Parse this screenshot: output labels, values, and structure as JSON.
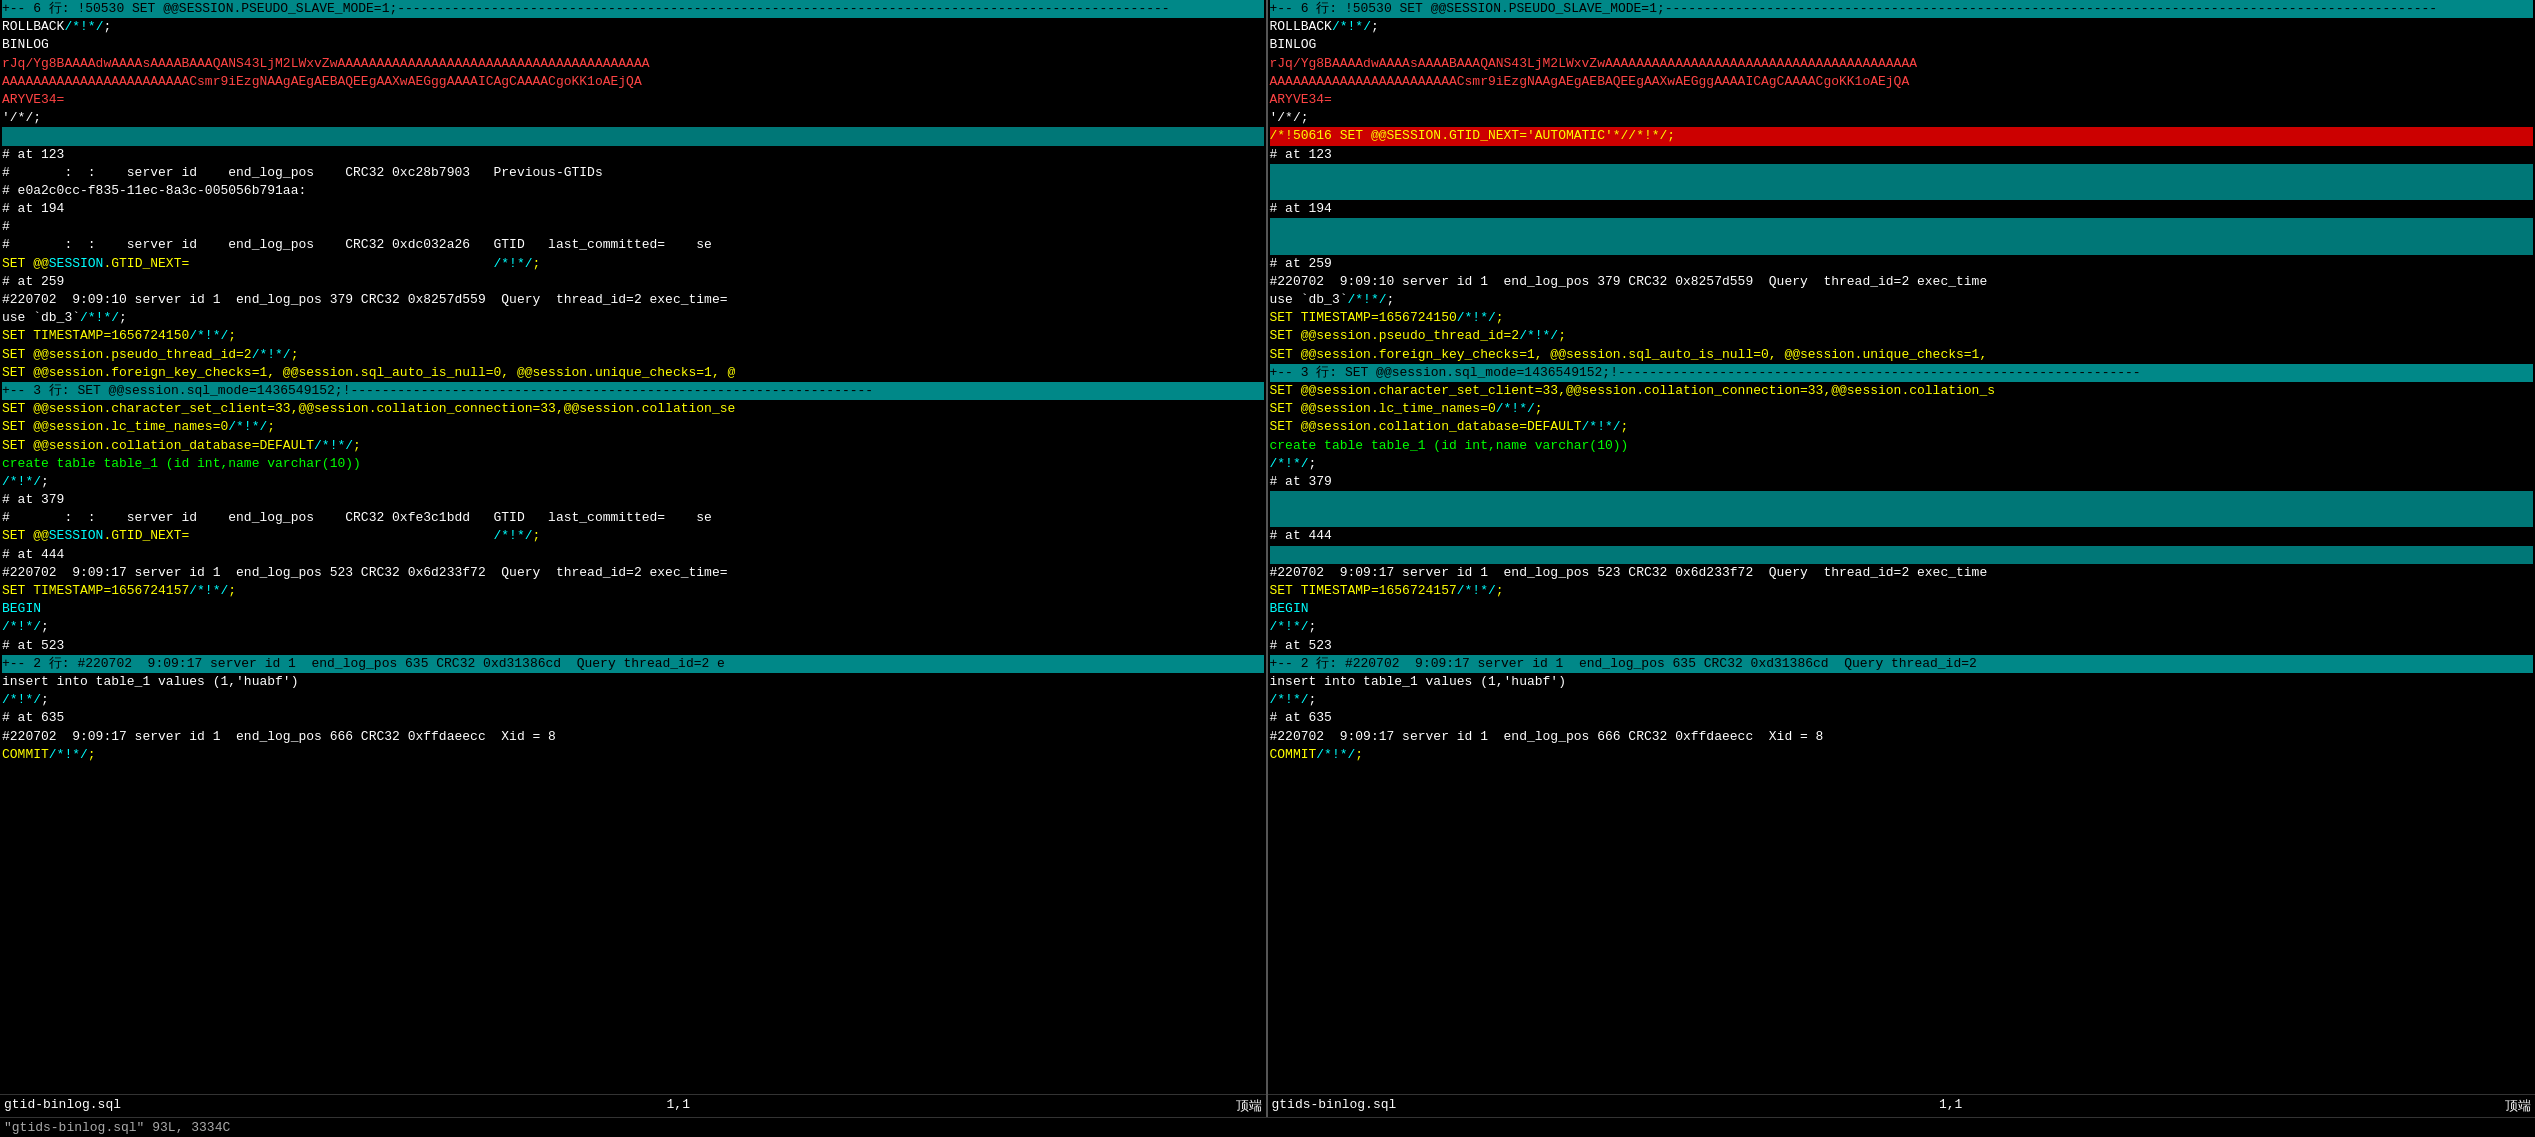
{
  "left_pane": {
    "status_file": "gtid-binlog.sql",
    "status_pos": "1,1",
    "status_loc": "顶端",
    "lines": [
      {
        "type": "bg-cyan",
        "text": "+-- 6 行: !50530 SET @@SESSION.PSEUDO_SLAVE_MODE=1;---------------------------------------------------------------------------------------------------"
      },
      {
        "type": "white",
        "text": "ROLLBACK/*!*/;"
      },
      {
        "type": "white",
        "text": "BINLOG"
      },
      {
        "type": "red",
        "text": "rJq/Yg8BAAAAdwAAAAsAAAABAAAQANS43LjM2LWxvZwAAAAAAAAAAAAAAAAAAAAAAAAAAAAAAAAAAAAAAAA"
      },
      {
        "type": "red",
        "text": "AAAAAAAAAAAAAAAAAAAAAAAACsmr9iEzgNAAgAEgAEBAQEEgAAXwAEGggAAAAICAgCAAAACgoKK1oAEjQA"
      },
      {
        "type": "red",
        "text": "ARYVE34="
      },
      {
        "type": "white",
        "text": "'/*/;"
      },
      {
        "type": "separator",
        "text": ""
      },
      {
        "type": "white",
        "text": "# at 123"
      },
      {
        "type": "white",
        "text": "#       :  :    server id    end_log_pos    CRC32 0xc28b7903   Previous-GTIDs"
      },
      {
        "type": "white",
        "text": "# e0a2c0cc-f835-11ec-8a3c-005056b791aa:"
      },
      {
        "type": "white",
        "text": "# at 194"
      },
      {
        "type": "white",
        "text": "#"
      },
      {
        "type": "white",
        "text": "#       :  :    server id    end_log_pos    CRC32 0xdc032a26   GTID   last_committed=    se"
      },
      {
        "type": "mixed_gtid",
        "text": "SET @@SESSION.GTID_NEXT=                                       /*!*/;"
      },
      {
        "type": "white",
        "text": "# at 259"
      },
      {
        "type": "white",
        "text": "#220702  9:09:10 server id 1  end_log_pos 379 CRC32 0x8257d559  Query  thread_id=2 exec_time="
      },
      {
        "type": "white",
        "text": "use `db_3`/*!*/;"
      },
      {
        "type": "yellow",
        "text": "SET TIMESTAMP=1656724150/*!*/;"
      },
      {
        "type": "yellow",
        "text": "SET @@session.pseudo_thread_id=2/*!*/;"
      },
      {
        "type": "yellow",
        "text": "SET @@session.foreign_key_checks=1, @@session.sql_auto_is_null=0, @@session.unique_checks=1, @"
      },
      {
        "type": "bg-cyan-sep",
        "text": "+-- 3 行: SET @@session.sql_mode=1436549152;!-------------------------------------------------------------------"
      },
      {
        "type": "yellow",
        "text": "SET @@session.character_set_client=33,@@session.collation_connection=33,@@session.collation_se"
      },
      {
        "type": "yellow",
        "text": "SET @@session.lc_time_names=0/*!*/;"
      },
      {
        "type": "yellow",
        "text": "SET @@session.collation_database=DEFAULT/*!*/;"
      },
      {
        "type": "green",
        "text": "create table table_1 (id int,name varchar(10))"
      },
      {
        "type": "white",
        "text": "/*!*/;"
      },
      {
        "type": "white",
        "text": "# at 379"
      },
      {
        "type": "white",
        "text": "#       :  :    server id    end_log_pos    CRC32 0xfe3c1bdd   GTID   last_committed=    se"
      },
      {
        "type": "mixed_gtid2",
        "text": "SET @@SESSION.GTID_NEXT=                                       /*!*/;"
      },
      {
        "type": "white",
        "text": "# at 444"
      },
      {
        "type": "white",
        "text": ""
      },
      {
        "type": "white",
        "text": "#220702  9:09:17 server id 1  end_log_pos 523 CRC32 0x6d233f72  Query  thread_id=2 exec_time="
      },
      {
        "type": "yellow",
        "text": "SET TIMESTAMP=1656724157/*!*/;"
      },
      {
        "type": "cyan",
        "text": "BEGIN"
      },
      {
        "type": "white",
        "text": "/*!*/;"
      },
      {
        "type": "white",
        "text": "# at 523"
      },
      {
        "type": "bg-cyan-sep2",
        "text": "+-- 2 行: #220702  9:09:17 server id 1  end_log_pos 635 CRC32 0xd31386cd  Query thread_id=2 e"
      },
      {
        "type": "white",
        "text": "insert into table_1 values (1,'huabf')"
      },
      {
        "type": "white",
        "text": "/*!*/;"
      },
      {
        "type": "white",
        "text": "# at 635"
      },
      {
        "type": "white",
        "text": "#220702  9:09:17 server id 1  end_log_pos 666 CRC32 0xffdaeecc  Xid = 8"
      },
      {
        "type": "yellow",
        "text": "COMMIT/*!*/;"
      }
    ]
  },
  "right_pane": {
    "status_file": "gtids-binlog.sql",
    "status_pos": "1,1",
    "status_loc": "顶端",
    "lines": [
      {
        "type": "bg-cyan",
        "text": "+-- 6 行: !50530 SET @@SESSION.PSEUDO_SLAVE_MODE=1;---------------------------------------------------------------------------------------------------"
      },
      {
        "type": "white",
        "text": "ROLLBACK/*!*/;"
      },
      {
        "type": "white",
        "text": "BINLOG"
      },
      {
        "type": "red",
        "text": "rJq/Yg8BAAAAdwAAAAsAAAABAAAQANS43LjM2LWxvZwAAAAAAAAAAAAAAAAAAAAAAAAAAAAAAAAAAAAAAAA"
      },
      {
        "type": "red",
        "text": "AAAAAAAAAAAAAAAAAAAAAAAACsmr9iEzgNAAgAEgAEBAQEEgAAXwAEGggAAAAICAgCAAAACgoKK1oAEjQA"
      },
      {
        "type": "red",
        "text": "ARYVE34="
      },
      {
        "type": "white",
        "text": "'/*/;"
      },
      {
        "type": "bg-red-line",
        "text": "/*!50616 SET @@SESSION.GTID_NEXT='AUTOMATIC'*//*!*/;"
      },
      {
        "type": "white",
        "text": "# at 123"
      },
      {
        "type": "separator-empty",
        "text": ""
      },
      {
        "type": "separator-empty2",
        "text": ""
      },
      {
        "type": "white",
        "text": "# at 194"
      },
      {
        "type": "separator-empty3",
        "text": ""
      },
      {
        "type": "separator-empty4",
        "text": ""
      },
      {
        "type": "white",
        "text": "# at 259"
      },
      {
        "type": "white",
        "text": "#220702  9:09:10 server id 1  end_log_pos 379 CRC32 0x8257d559  Query  thread_id=2 exec_time"
      },
      {
        "type": "white",
        "text": "use `db_3`/*!*/;"
      },
      {
        "type": "yellow",
        "text": "SET TIMESTAMP=1656724150/*!*/;"
      },
      {
        "type": "yellow",
        "text": "SET @@session.pseudo_thread_id=2/*!*/;"
      },
      {
        "type": "yellow",
        "text": "SET @@session.foreign_key_checks=1, @@session.sql_auto_is_null=0, @@session.unique_checks=1,"
      },
      {
        "type": "bg-cyan-sep",
        "text": "+-- 3 行: SET @@session.sql_mode=1436549152;!-------------------------------------------------------------------"
      },
      {
        "type": "yellow",
        "text": "SET @@session.character_set_client=33,@@session.collation_connection=33,@@session.collation_s"
      },
      {
        "type": "yellow",
        "text": "SET @@session.lc_time_names=0/*!*/;"
      },
      {
        "type": "yellow",
        "text": "SET @@session.collation_database=DEFAULT/*!*/;"
      },
      {
        "type": "green",
        "text": "create table table_1 (id int,name varchar(10))"
      },
      {
        "type": "white",
        "text": "/*!*/;"
      },
      {
        "type": "white",
        "text": "# at 379"
      },
      {
        "type": "separator-empty5",
        "text": ""
      },
      {
        "type": "separator-empty6",
        "text": ""
      },
      {
        "type": "white",
        "text": "# at 444"
      },
      {
        "type": "separator-empty7",
        "text": ""
      },
      {
        "type": "white",
        "text": "#220702  9:09:17 server id 1  end_log_pos 523 CRC32 0x6d233f72  Query  thread_id=2 exec_time"
      },
      {
        "type": "yellow",
        "text": "SET TIMESTAMP=1656724157/*!*/;"
      },
      {
        "type": "cyan",
        "text": "BEGIN"
      },
      {
        "type": "white",
        "text": "/*!*/;"
      },
      {
        "type": "white",
        "text": "# at 523"
      },
      {
        "type": "bg-cyan-sep2",
        "text": "+-- 2 行: #220702  9:09:17 server id 1  end_log_pos 635 CRC32 0xd31386cd  Query thread_id=2"
      },
      {
        "type": "white",
        "text": "insert into table_1 values (1,'huabf')"
      },
      {
        "type": "white",
        "text": "/*!*/;"
      },
      {
        "type": "white",
        "text": "# at 635"
      },
      {
        "type": "white",
        "text": "#220702  9:09:17 server id 1  end_log_pos 666 CRC32 0xffdaeecc  Xid = 8"
      },
      {
        "type": "yellow",
        "text": "COMMIT/*!*/;"
      }
    ]
  },
  "bottom_bar": {
    "text": "\"gtids-binlog.sql\" 93L, 3334C"
  },
  "colors": {
    "bg_cyan": "#008888",
    "bg_red": "#aa0000",
    "text_red": "#ff3333",
    "text_yellow": "#ffff00",
    "text_cyan": "#00ffff",
    "text_green": "#00ff00",
    "text_white": "#ffffff"
  }
}
